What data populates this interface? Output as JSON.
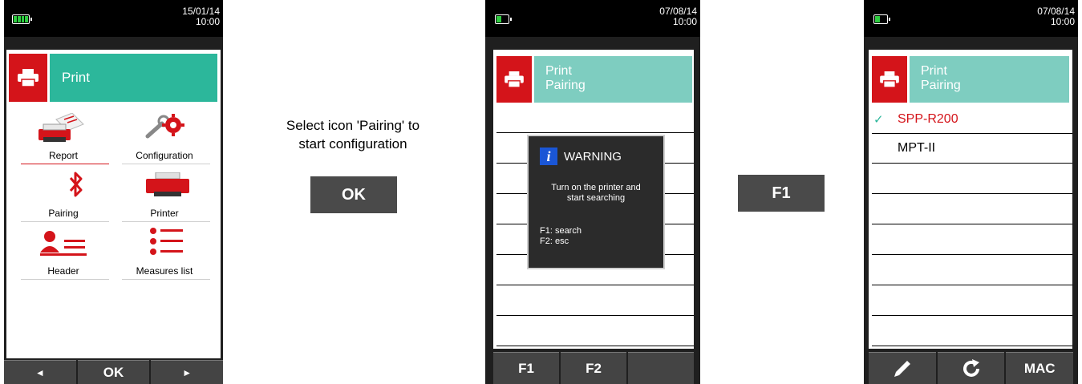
{
  "screen1": {
    "date": "15/01/14",
    "time": "10:00",
    "header_title": "Print",
    "menu": [
      {
        "label": "Report",
        "icon": "report-printer-icon"
      },
      {
        "label": "Configuration",
        "icon": "configuration-gears-icon"
      },
      {
        "label": "Pairing",
        "icon": "bluetooth-icon"
      },
      {
        "label": "Printer",
        "icon": "printer-icon"
      },
      {
        "label": "Header",
        "icon": "header-person-icon"
      },
      {
        "label": "Measures list",
        "icon": "measures-list-icon"
      }
    ],
    "softkeys": [
      "◄",
      "OK",
      "►"
    ]
  },
  "instruction": {
    "line1": "Select icon 'Pairing' to",
    "line2": "start configuration",
    "button": "OK"
  },
  "screen2": {
    "date": "07/08/14",
    "time": "10:00",
    "header_line1": "Print",
    "header_line2": "Pairing",
    "warning": {
      "title": "WARNING",
      "line1": "Turn on the printer and",
      "line2": "start searching",
      "f1": "F1: search",
      "f2": "F2: esc"
    },
    "softkeys": [
      "F1",
      "F2",
      ""
    ]
  },
  "step2_button": "F1",
  "screen3": {
    "date": "07/08/14",
    "time": "10:00",
    "header_line1": "Print",
    "header_line2": "Pairing",
    "check": "✓",
    "devices": [
      "SPP-R200",
      "MPT-II"
    ],
    "softkeys": [
      "",
      "",
      "MAC"
    ]
  },
  "colors": {
    "brand_red": "#d4141a",
    "header_teal": "#2cb79b",
    "header_teal_light": "#7ecdc0",
    "softkey_gray": "#444444"
  }
}
